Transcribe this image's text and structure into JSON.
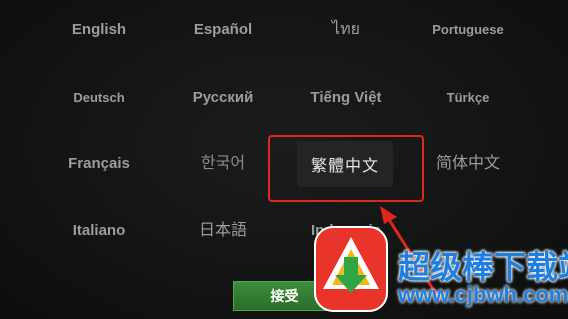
{
  "languages": {
    "row1": [
      "English",
      "Español",
      "ไทย",
      "Portuguese"
    ],
    "row2": [
      "Deutsch",
      "Русский",
      "Tiếng Việt",
      "Türkçe"
    ],
    "row3": [
      "Français",
      "한국어",
      "繁體中文",
      "简体中文"
    ],
    "row4": [
      "Italiano",
      "日本語",
      "Indonesia"
    ]
  },
  "selected_language": "繁體中文",
  "accept_label": "接受",
  "watermark": {
    "title": "超级棒下载站",
    "url": "www.cjbwh.com"
  },
  "colors": {
    "highlight": "#e0261f",
    "accept_button": "#2f7a2f",
    "watermark_text": "#1e7fe0"
  }
}
